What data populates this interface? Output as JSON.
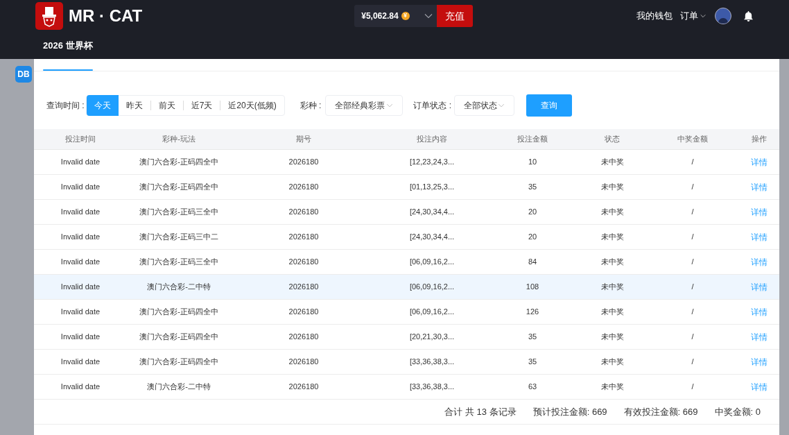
{
  "header": {
    "brand": "MR · CAT",
    "nav_item": "2026 世界杯",
    "balance": "¥5,062.84",
    "coin_symbol": "¥",
    "recharge_button": "充值",
    "wallet_link": "我的钱包",
    "orders_menu": "订单"
  },
  "backdrop": {
    "badge": "DB"
  },
  "filters": {
    "time_label": "查询时间 :",
    "time_options": [
      {
        "label": "今天",
        "selected": true
      },
      {
        "label": "昨天",
        "selected": false
      },
      {
        "label": "前天",
        "selected": false
      },
      {
        "label": "近7天",
        "selected": false
      },
      {
        "label": "近20天(低频)",
        "selected": false
      }
    ],
    "lottery_label": "彩种 :",
    "lottery_value": "全部经典彩票",
    "status_label": "订单状态 :",
    "status_value": "全部状态",
    "query_button": "查询"
  },
  "table": {
    "columns": [
      "投注时间",
      "彩种-玩法",
      "期号",
      "投注内容",
      "投注金额",
      "状态",
      "中奖金额",
      "操作"
    ],
    "rows": [
      {
        "cells": [
          "Invalid date",
          "澳门六合彩-正码四全中",
          "2026180",
          "[12,23,24,3...",
          "10",
          "未中奖",
          "/",
          "详情"
        ],
        "highlighted": false
      },
      {
        "cells": [
          "Invalid date",
          "澳门六合彩-正码四全中",
          "2026180",
          "[01,13,25,3...",
          "35",
          "未中奖",
          "/",
          "详情"
        ],
        "highlighted": false
      },
      {
        "cells": [
          "Invalid date",
          "澳门六合彩-正码三全中",
          "2026180",
          "[24,30,34,4...",
          "20",
          "未中奖",
          "/",
          "详情"
        ],
        "highlighted": false
      },
      {
        "cells": [
          "Invalid date",
          "澳门六合彩-正码三中二",
          "2026180",
          "[24,30,34,4...",
          "20",
          "未中奖",
          "/",
          "详情"
        ],
        "highlighted": false
      },
      {
        "cells": [
          "Invalid date",
          "澳门六合彩-正码三全中",
          "2026180",
          "[06,09,16,2...",
          "84",
          "未中奖",
          "/",
          "详情"
        ],
        "highlighted": false
      },
      {
        "cells": [
          "Invalid date",
          "澳门六合彩-二中特",
          "2026180",
          "[06,09,16,2...",
          "108",
          "未中奖",
          "/",
          "详情"
        ],
        "highlighted": true
      },
      {
        "cells": [
          "Invalid date",
          "澳门六合彩-正码四全中",
          "2026180",
          "[06,09,16,2...",
          "126",
          "未中奖",
          "/",
          "详情"
        ],
        "highlighted": false
      },
      {
        "cells": [
          "Invalid date",
          "澳门六合彩-正码四全中",
          "2026180",
          "[20,21,30,3...",
          "35",
          "未中奖",
          "/",
          "详情"
        ],
        "highlighted": false
      },
      {
        "cells": [
          "Invalid date",
          "澳门六合彩-正码四全中",
          "2026180",
          "[33,36,38,3...",
          "35",
          "未中奖",
          "/",
          "详情"
        ],
        "highlighted": false
      },
      {
        "cells": [
          "Invalid date",
          "澳门六合彩-二中特",
          "2026180",
          "[33,36,38,3...",
          "63",
          "未中奖",
          "/",
          "详情"
        ],
        "highlighted": false
      }
    ]
  },
  "summary": [
    "合计 共 13 条记录",
    "预计投注金额: 669",
    "有效投注金额: 669",
    "中奖金额: 0"
  ]
}
